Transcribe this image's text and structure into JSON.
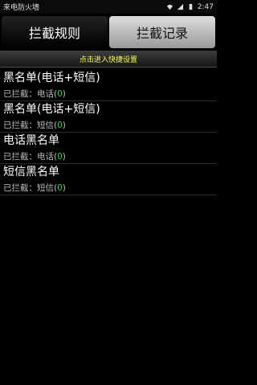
{
  "statusbar": {
    "app_title": "来电防火墙",
    "time": "2:47"
  },
  "tabs": [
    {
      "label": "拦截规则",
      "active": false
    },
    {
      "label": "拦截记录",
      "active": true
    }
  ],
  "hint": "点击进入快捷设置",
  "items": [
    {
      "title": "黑名单(电话+短信)",
      "prefix": "已拦截：",
      "type": "电话",
      "count_open": "(",
      "count": "0",
      "count_close": ")"
    },
    {
      "title": "黑名单(电话+短信)",
      "prefix": "已拦截：",
      "type": "短信",
      "count_open": "(",
      "count": "0",
      "count_close": ")"
    },
    {
      "title": "电话黑名单",
      "prefix": "已拦截：",
      "type": "电话",
      "count_open": "(",
      "count": "0",
      "count_close": ")"
    },
    {
      "title": "短信黑名单",
      "prefix": "已拦截：",
      "type": "短信",
      "count_open": "(",
      "count": "0",
      "count_close": ")"
    }
  ],
  "colors": {
    "accent_yellow": "#ffff3d",
    "count_green": "#37d037",
    "background": "#000000"
  }
}
